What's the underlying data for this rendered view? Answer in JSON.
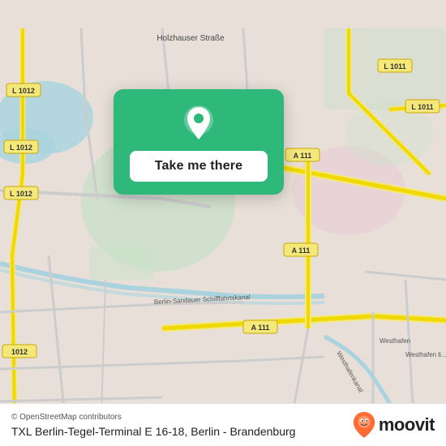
{
  "map": {
    "background_color": "#e8e0d8"
  },
  "card": {
    "button_label": "Take me there",
    "background_color": "#2eb87a"
  },
  "bottom_bar": {
    "copyright": "© OpenStreetMap contributors",
    "location_name": "TXL Berlin-Tegel-Terminal E 16-18, Berlin - Brandenburg"
  },
  "moovit": {
    "logo_text": "moovit"
  },
  "road_labels": {
    "holzhauser": "Holzhauser Straße",
    "l1012_1": "L 1012",
    "l1012_2": "L 1012",
    "l1012_3": "L 1012",
    "l1011_1": "L 1011",
    "l1011_2": "L 1011",
    "a111_1": "A 111",
    "a111_2": "A 111",
    "a111_3": "A 111",
    "berlin_sandauer": "Berlin-Sandauer Schifffahrtskanal",
    "westhafen_1": "Westhafen",
    "westhafen_2": "Westhafen",
    "westhafenkanal": "Westhafenkanal"
  }
}
